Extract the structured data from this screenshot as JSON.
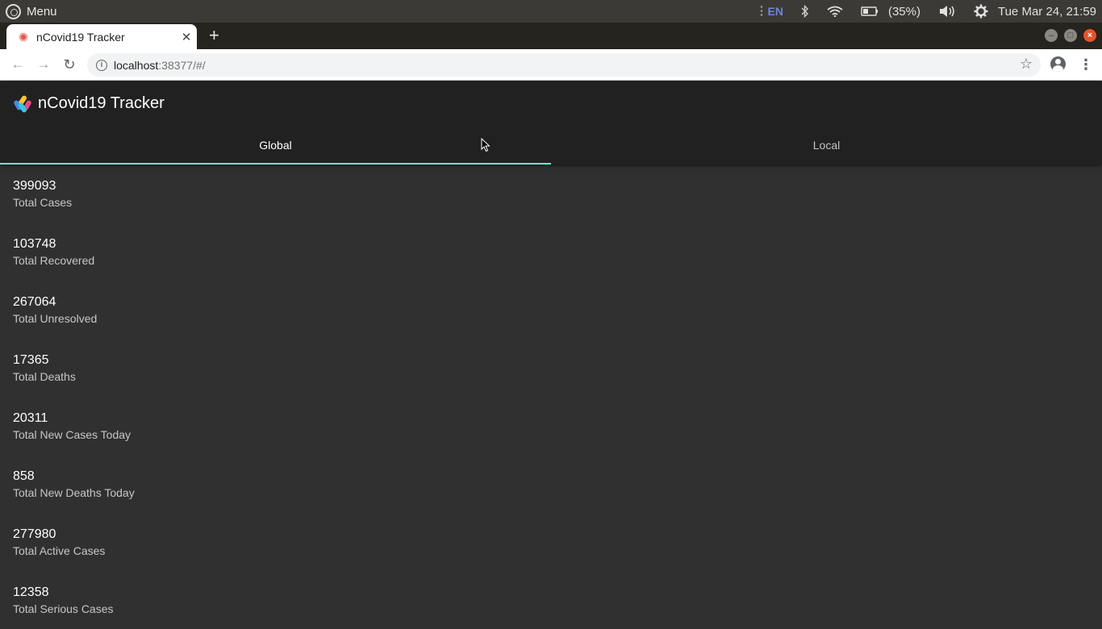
{
  "os_panel": {
    "menu_label": "Menu",
    "language": "EN",
    "battery": "(35%)",
    "datetime": "Tue Mar 24, 21:59"
  },
  "browser": {
    "tab_title": "nCovid19 Tracker",
    "new_tab": "+",
    "close_tab": "✕",
    "url_host": "localhost",
    "url_rest": ":38377/#/"
  },
  "app": {
    "title": "nCovid19 Tracker",
    "tabs": [
      {
        "label": "Global",
        "selected": true
      },
      {
        "label": "Local",
        "selected": false
      }
    ],
    "accent_color": "#64ffda"
  },
  "stats": [
    {
      "value": "399093",
      "label": "Total Cases"
    },
    {
      "value": "103748",
      "label": "Total Recovered"
    },
    {
      "value": "267064",
      "label": "Total Unresolved"
    },
    {
      "value": "17365",
      "label": "Total Deaths"
    },
    {
      "value": "20311",
      "label": "Total New Cases Today"
    },
    {
      "value": "858",
      "label": "Total New Deaths Today"
    },
    {
      "value": "277980",
      "label": "Total Active Cases"
    },
    {
      "value": "12358",
      "label": "Total Serious Cases"
    }
  ]
}
